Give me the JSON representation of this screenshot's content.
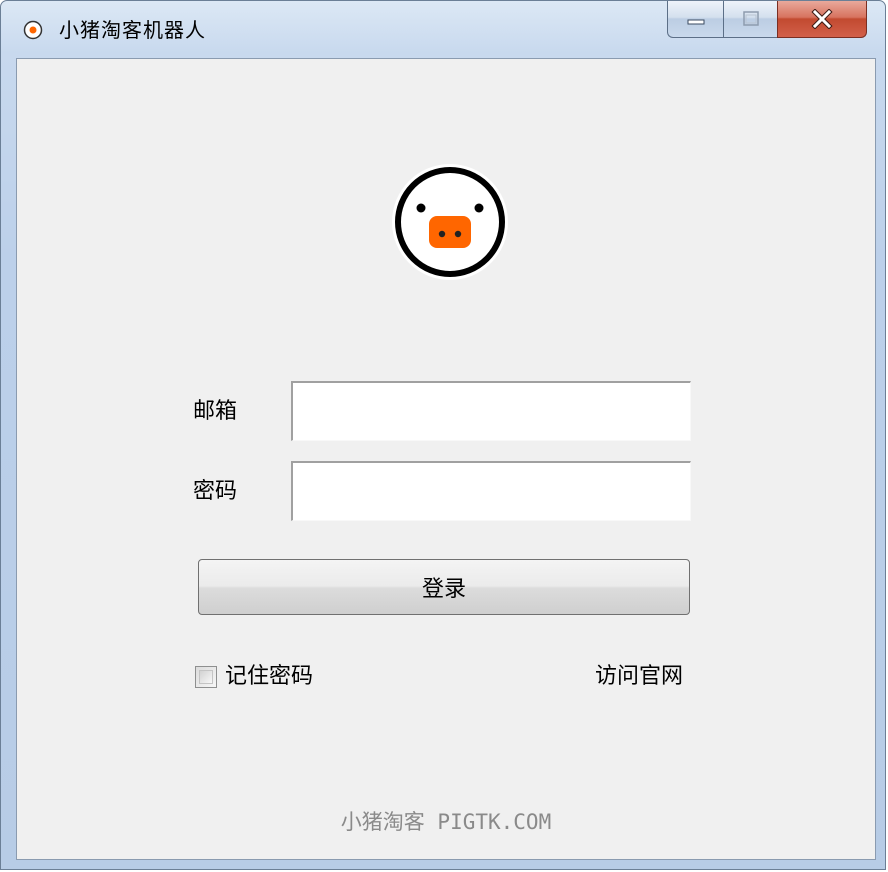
{
  "window": {
    "title": "小猪淘客机器人"
  },
  "captions": {
    "minimize_icon": "minimize-icon",
    "maximize_icon": "maximize-icon",
    "close_icon": "close-icon"
  },
  "logo": {
    "icon": "pig-face-logo",
    "snout_color": "#ff6600"
  },
  "form": {
    "email_label": "邮箱",
    "email_value": "",
    "password_label": "密码",
    "password_value": "",
    "login_label": "登录",
    "remember_label": "记住密码",
    "remember_checked": false,
    "visit_link": "访问官网"
  },
  "footer": {
    "text": "小猪淘客 PIGTK.COM"
  }
}
